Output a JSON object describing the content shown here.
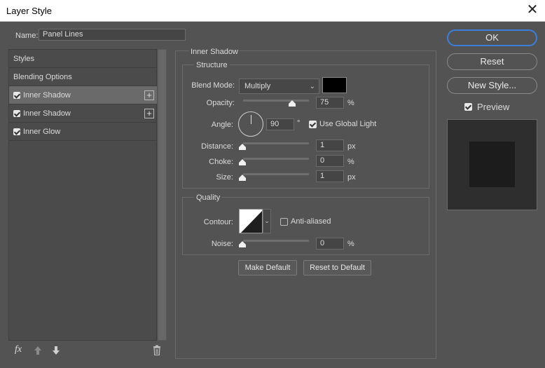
{
  "window": {
    "title": "Layer Style",
    "close_glyph": "✕"
  },
  "name_field": {
    "label": "Name:",
    "value": "Panel Lines"
  },
  "styles_list": {
    "items": [
      {
        "label": "Styles",
        "checked": null,
        "selected": false,
        "has_add": false
      },
      {
        "label": "Blending Options",
        "checked": null,
        "selected": false,
        "has_add": false
      },
      {
        "label": "Inner Shadow",
        "checked": true,
        "selected": true,
        "has_add": true
      },
      {
        "label": "Inner Shadow",
        "checked": true,
        "selected": false,
        "has_add": true
      },
      {
        "label": "Inner Glow",
        "checked": true,
        "selected": false,
        "has_add": false
      }
    ],
    "add_glyph": "+"
  },
  "footer": {
    "fx_label": "fx"
  },
  "panel": {
    "title": "Inner Shadow",
    "structure": {
      "title": "Structure",
      "blend_mode_label": "Blend Mode:",
      "blend_mode_value": "Multiply",
      "swatch_color": "#000000",
      "opacity_label": "Opacity:",
      "opacity_value": "75",
      "opacity_unit": "%",
      "angle_label": "Angle:",
      "angle_value": "90",
      "angle_unit": "°",
      "global_light_label": "Use Global Light",
      "global_light_checked": true,
      "distance_label": "Distance:",
      "distance_value": "1",
      "distance_unit": "px",
      "choke_label": "Choke:",
      "choke_value": "0",
      "choke_unit": "%",
      "size_label": "Size:",
      "size_value": "1",
      "size_unit": "px"
    },
    "quality": {
      "title": "Quality",
      "contour_label": "Contour:",
      "anti_aliased_label": "Anti-aliased",
      "anti_aliased_checked": false,
      "noise_label": "Noise:",
      "noise_value": "0",
      "noise_unit": "%"
    },
    "make_default_label": "Make Default",
    "reset_default_label": "Reset to Default"
  },
  "actions": {
    "ok_label": "OK",
    "reset_label": "Reset",
    "new_style_label": "New Style...",
    "preview_label": "Preview",
    "preview_checked": true
  },
  "colors": {
    "dialog_bg": "#535353",
    "accent": "#3b7fd8",
    "selected_item": "#6a6a6a"
  }
}
